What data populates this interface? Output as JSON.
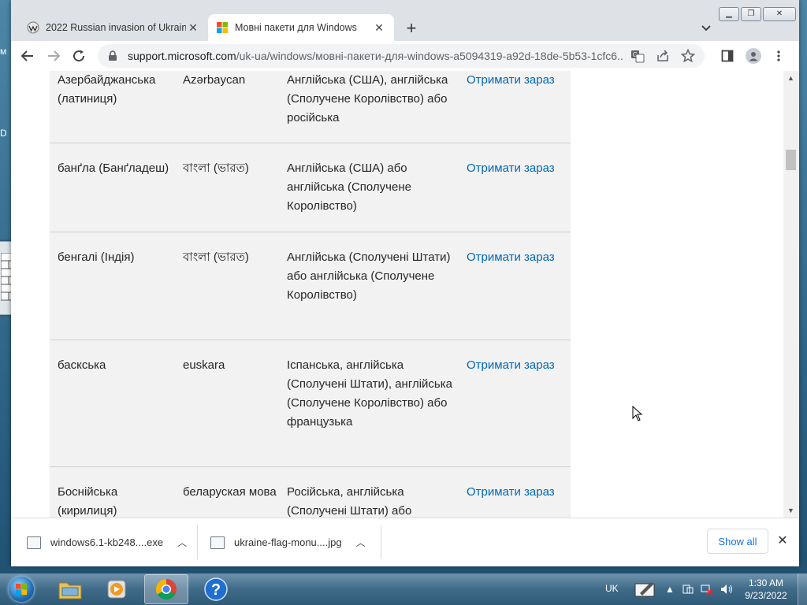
{
  "tabs": [
    {
      "title": "2022 Russian invasion of Ukraine",
      "icon": "wikipedia-icon",
      "active": false
    },
    {
      "title": "Мовні пакети для Windows",
      "icon": "microsoft-icon",
      "active": true
    }
  ],
  "address_bar": {
    "domain": "support.microsoft.com",
    "path": "/uk-ua/windows/мовні-пакети-для-windows-a5094319-a92d-18de-5b53-1cfc6..."
  },
  "table": {
    "link_label": "Отримати зараз",
    "rows": [
      {
        "language": "Азербайджанська (латиниця)",
        "native": "Azərbaycan",
        "base": "Англійська (США), англійська (Сполучене Королівство) або російська"
      },
      {
        "language": "банґла (Банґладеш)",
        "native": "বাংলা (ভারত)",
        "base": "Англійська (США) або англійська (Сполучене Королівство)"
      },
      {
        "language": "бенгалі (Індія)",
        "native": "বাংলা (ভারত)",
        "base": "Англійська (Сполучені Штати) або англійська (Сполучене Королівство)"
      },
      {
        "language": "баскська",
        "native": "euskara",
        "base": "Іспанська, англійська (Сполучені Штати), англійська (Сполучене Королівство) або французька"
      },
      {
        "language": "Боснійська (кирилиця)",
        "native": "беларуская мова",
        "base": "Російська, англійська (Сполучені Штати) або"
      }
    ]
  },
  "downloads": {
    "items": [
      {
        "filename": "windows6.1-kb248....exe"
      },
      {
        "filename": "ukraine-flag-monu....jpg"
      }
    ],
    "show_all": "Show all"
  },
  "taskbar": {
    "language": "UK",
    "time": "1:30 AM",
    "date": "9/23/2022"
  },
  "colors": {
    "link": "#0067b8",
    "table_bg": "#f2f2f2",
    "tab_strip": "#dee1e6"
  }
}
